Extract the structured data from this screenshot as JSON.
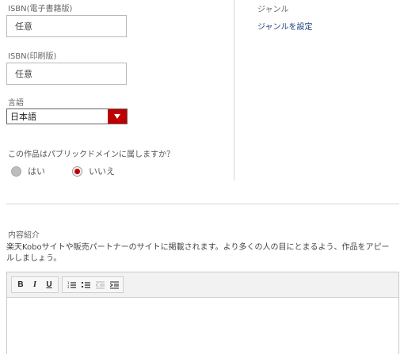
{
  "fields": {
    "isbn_ebook": {
      "label": "ISBN(電子書籍版)",
      "value": "任意"
    },
    "isbn_print": {
      "label": "ISBN(印刷版)",
      "value": "任意"
    },
    "language": {
      "label": "言語",
      "value": "日本語"
    }
  },
  "public_domain": {
    "question": "この作品はパブリックドメインに属しますか？",
    "options": [
      {
        "label": "はい",
        "selected": false
      },
      {
        "label": "いいえ",
        "selected": true
      }
    ]
  },
  "genre": {
    "label": "ジャンル",
    "link": "ジャンルを設定"
  },
  "description": {
    "label": "内容紹介",
    "text": "楽天Koboサイトや販売パートナーのサイトに掲載されます。より多くの人の目にとまるよう、作品をアピールしましょう。"
  },
  "editor": {
    "toolbar": {
      "bold": "B",
      "italic": "I",
      "underline": "U"
    },
    "content": ""
  },
  "colors": {
    "accent": "#bf0000",
    "link": "#1d3f7a"
  }
}
